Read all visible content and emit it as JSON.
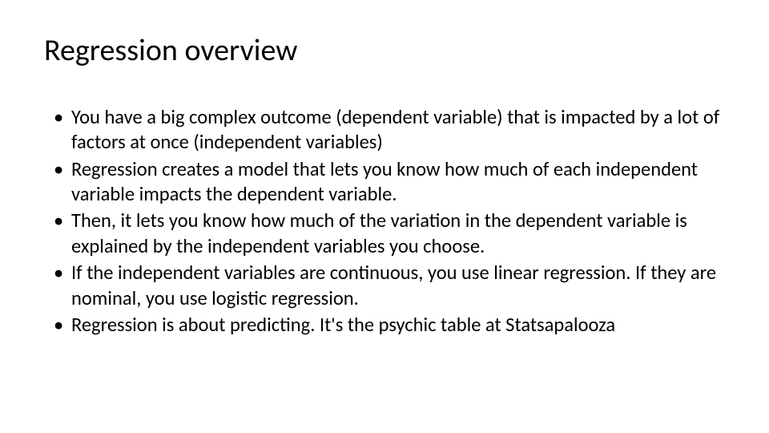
{
  "slide": {
    "title": "Regression overview",
    "bullets": [
      "You have a big complex outcome (dependent variable) that is impacted by a lot of factors at once (independent variables)",
      "Regression creates a model that lets you know how much of each independent variable impacts the dependent variable.",
      "Then, it lets you know how much of the variation in the dependent variable is explained by the independent variables you choose.",
      "If the independent variables are continuous, you use linear regression. If they are nominal, you use logistic regression.",
      "Regression is about predicting.  It's the psychic table at Statsapalooza"
    ]
  }
}
